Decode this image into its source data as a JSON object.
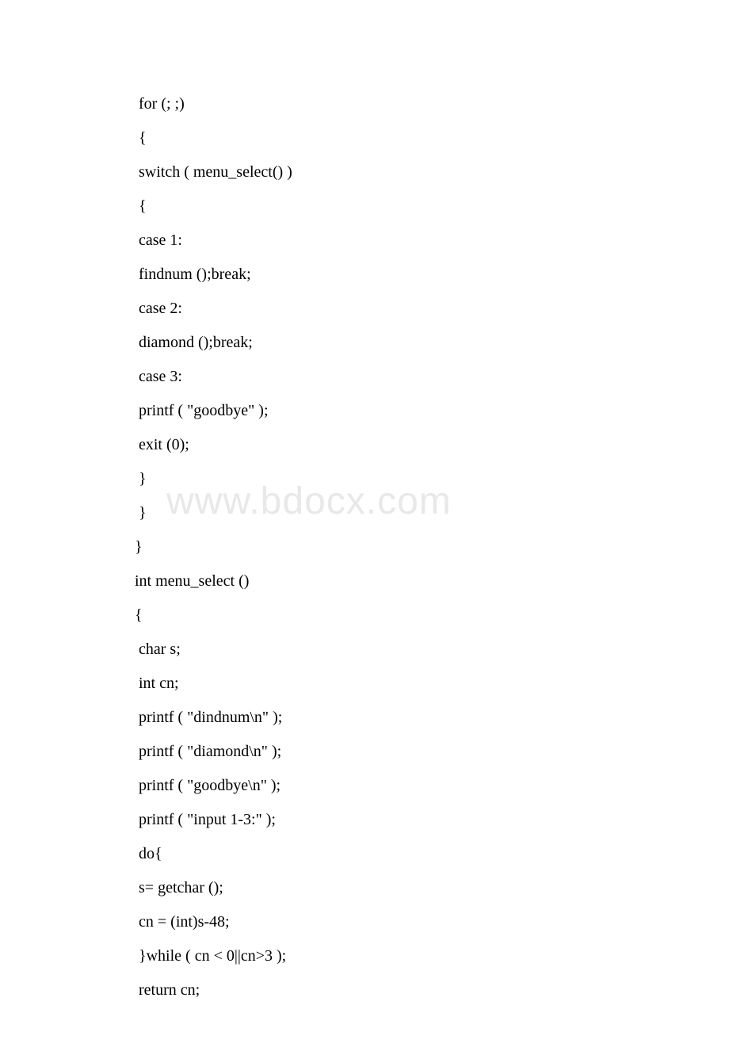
{
  "watermark": "www.bdocx.com",
  "code": {
    "lines": [
      " for (; ;)",
      " {",
      " switch ( menu_select() )",
      " {",
      " case 1:",
      " findnum ();break;",
      " case 2:",
      " diamond ();break;",
      " case 3:",
      " printf ( \"goodbye\" );",
      " exit (0);",
      " }",
      " }",
      "}",
      "int menu_select ()",
      "{",
      " char s;",
      " int cn;",
      " printf ( \"dindnum\\n\" );",
      " printf ( \"diamond\\n\" );",
      " printf ( \"goodbye\\n\" );",
      " printf ( \"input 1-3:\" );",
      " do{",
      " s= getchar ();",
      " cn = (int)s-48;",
      " }while ( cn < 0||cn>3 );",
      " return cn;"
    ]
  }
}
